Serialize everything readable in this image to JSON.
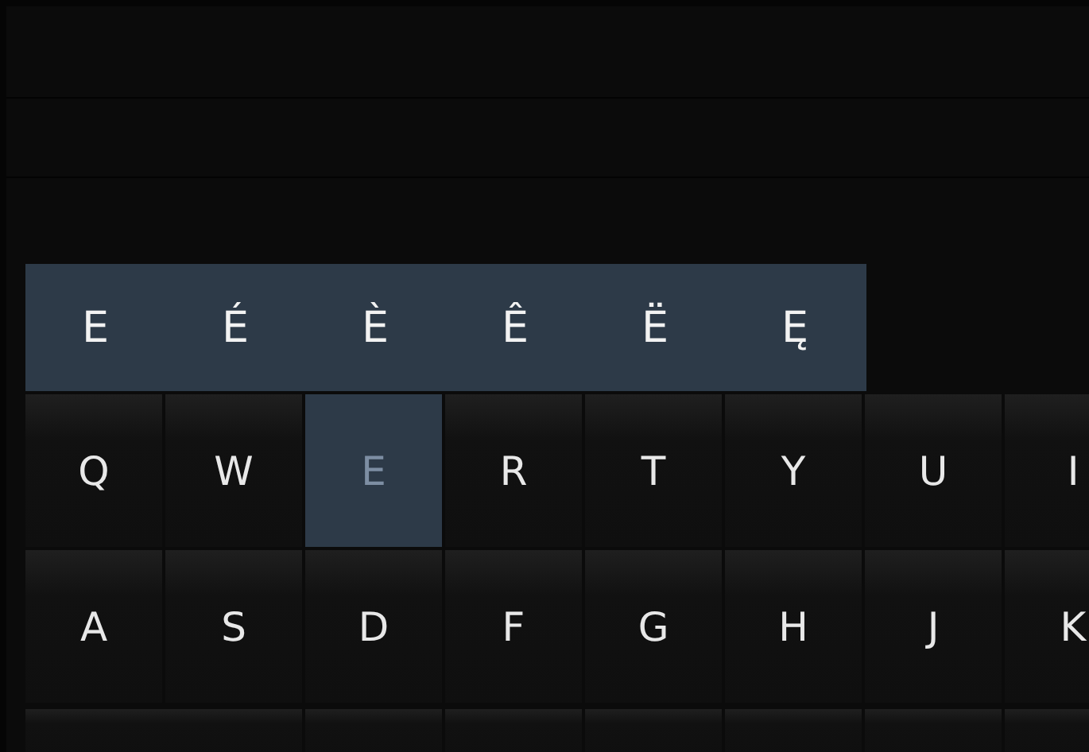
{
  "accent_popup": {
    "keys": [
      "E",
      "É",
      "È",
      "Ê",
      "Ë",
      "Ę"
    ]
  },
  "rows": [
    {
      "keys": [
        {
          "label": "Q",
          "pressed": false
        },
        {
          "label": "W",
          "pressed": false
        },
        {
          "label": "E",
          "pressed": true
        },
        {
          "label": "R",
          "pressed": false
        },
        {
          "label": "T",
          "pressed": false
        },
        {
          "label": "Y",
          "pressed": false
        },
        {
          "label": "U",
          "pressed": false
        },
        {
          "label": "I",
          "pressed": false
        }
      ]
    },
    {
      "keys": [
        {
          "label": "A",
          "pressed": false
        },
        {
          "label": "S",
          "pressed": false
        },
        {
          "label": "D",
          "pressed": false
        },
        {
          "label": "F",
          "pressed": false
        },
        {
          "label": "G",
          "pressed": false
        },
        {
          "label": "H",
          "pressed": false
        },
        {
          "label": "J",
          "pressed": false
        },
        {
          "label": "K",
          "pressed": false
        }
      ]
    }
  ]
}
